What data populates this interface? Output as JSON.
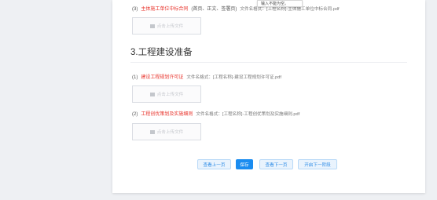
{
  "item_top": {
    "index": "(3)",
    "title": "主体施工单位中标合同",
    "paren": "(首页、正文、签署页)",
    "hint": "文件名格式：[工程名称]-主体施工单位中标合同.pdf",
    "upload_label": "点击上传文件"
  },
  "tooltip": "输入不能为空。",
  "section": {
    "title": "3.工程建设准备"
  },
  "items": [
    {
      "index": "(1)",
      "title": "建设工程规划许可证",
      "hint": "文件名格式：[工程名称]-建设工程规划许可证.pdf",
      "upload_label": "点击上传文件"
    },
    {
      "index": "(2)",
      "title": "工程创优策划及实施细则",
      "hint": "文件名格式：[工程名称]-工程创优策划及实施细则.pdf",
      "upload_label": "点击上传文件"
    }
  ],
  "buttons": {
    "prev": "查看上一页",
    "save": "保存",
    "next": "查看下一页",
    "next_stage": "开启下一阶段"
  }
}
